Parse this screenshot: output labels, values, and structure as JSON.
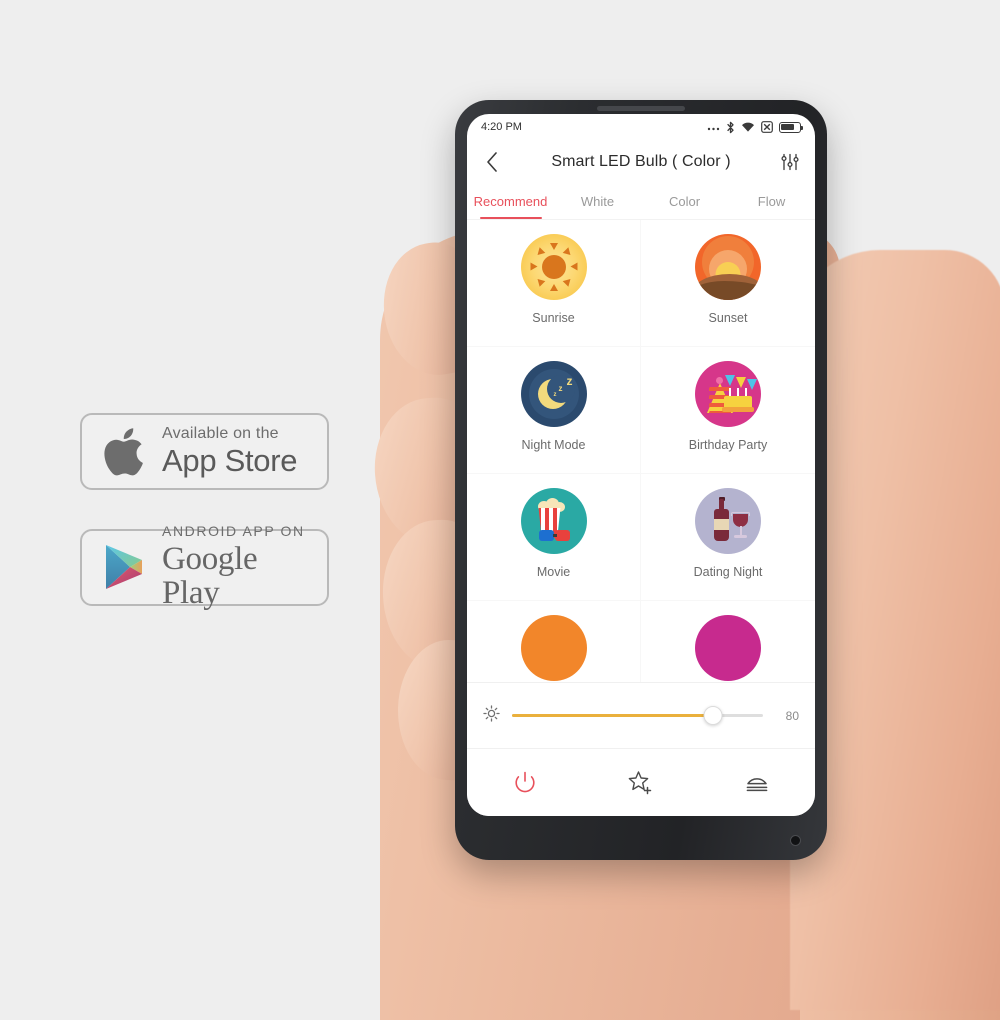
{
  "background_color": "#eeeeee",
  "badges": [
    {
      "id": "appstore",
      "logo_icon": "apple-logo-icon",
      "small_text": "Available on the",
      "big_text": "App Store"
    },
    {
      "id": "googleplay",
      "logo_icon": "google-play-triangle-icon",
      "small_text": "ANDROID APP ON",
      "big_text": "Google Play"
    }
  ],
  "phone": {
    "body_color": "#2b2d30",
    "status_bar": {
      "time": "4:20 PM",
      "icons": [
        "more-dots-icon",
        "bluetooth-icon",
        "wifi-icon",
        "alarm-box-icon",
        "battery-icon"
      ],
      "battery_level_percent": 72
    },
    "app_bar": {
      "back_icon": "chevron-left-icon",
      "title": "Smart LED Bulb ( Color )",
      "settings_icon": "sliders-icon"
    },
    "tabs": [
      {
        "label": "Recommend",
        "active": true
      },
      {
        "label": "White",
        "active": false
      },
      {
        "label": "Color",
        "active": false
      },
      {
        "label": "Flow",
        "active": false
      }
    ],
    "accent_color": "#e8505b",
    "scenes": [
      {
        "label": "Sunrise",
        "icon": "sunrise-icon",
        "color": "#f9c94f"
      },
      {
        "label": "Sunset",
        "icon": "sunset-icon",
        "color": "#f2662a"
      },
      {
        "label": "Night Mode",
        "icon": "night-mode-icon",
        "color": "#2b4a6e"
      },
      {
        "label": "Birthday Party",
        "icon": "birthday-party-icon",
        "color": "#d6368a"
      },
      {
        "label": "Movie",
        "icon": "movie-icon",
        "color": "#2aa9a4"
      },
      {
        "label": "Dating Night",
        "icon": "dating-night-icon",
        "color": "#b4b3cf"
      }
    ],
    "scenes_partial_row": [
      {
        "label": "",
        "icon": "scene-partial-orange-icon",
        "color": "#f2862a"
      },
      {
        "label": "",
        "icon": "scene-partial-magenta-icon",
        "color": "#c72a8e"
      }
    ],
    "brightness": {
      "icon": "brightness-sun-icon",
      "value": "80",
      "percent": 80,
      "fill_color": "#eab03c"
    },
    "actions": [
      {
        "name": "power",
        "icon": "power-icon",
        "color": "#e8505b"
      },
      {
        "name": "favorite",
        "icon": "star-plus-icon",
        "color": "#4a4a4a"
      },
      {
        "name": "eject",
        "icon": "eject-icon",
        "color": "#4a4a4a"
      }
    ]
  }
}
